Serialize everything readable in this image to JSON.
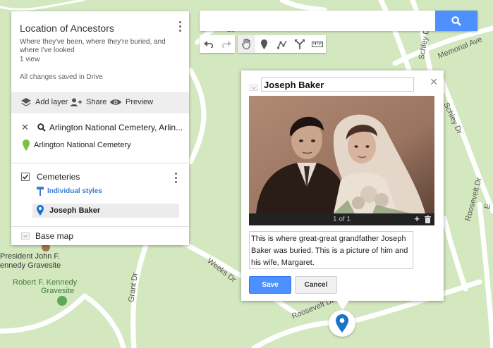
{
  "panel": {
    "title": "Location of Ancestors",
    "description": "Where they've been, where they're buried, and where I've looked",
    "views": "1 view",
    "saved_status": "All changes saved in Drive",
    "actions": {
      "add_layer": "Add layer",
      "share": "Share",
      "preview": "Preview"
    },
    "search_result": {
      "query": "Arlington National Cemetery, Arlin...",
      "place": "Arlington National Cemetery"
    },
    "layer": {
      "name": "Cemeteries",
      "style": "Individual styles",
      "item": "Joseph Baker"
    },
    "base_map": "Base map"
  },
  "search": {
    "value": "",
    "placeholder": ""
  },
  "info_window": {
    "title": "Joseph Baker",
    "photo_counter": "1 of 1",
    "description": "This is where great-great grandfather Joseph Baker was buried. This is a picture of him and his wife, Margaret.",
    "save": "Save",
    "cancel": "Cancel"
  },
  "map_labels": {
    "memorial_ave": "Memorial Ave",
    "schley_dr": "Schley Dr",
    "schley_dr_2": "Schley Dr",
    "roosevelt_dr": "Roosevelt Dr",
    "roosevelt_dr_2": "Roosevelt Dr",
    "weeks_dr": "Weeks Dr",
    "grant_dr": "Grant Dr",
    "cu": "Cu",
    "jfk_1": "President John F.",
    "jfk_2": "ennedy Gravesite",
    "rfk_1": "Robert F. Kennedy",
    "rfk_2": "Gravesite",
    "edge": "E"
  },
  "colors": {
    "accent": "#4d90fe",
    "marker": "#1a73c9",
    "pin_green": "#7cc242",
    "map_bg": "#d4e8c0"
  }
}
